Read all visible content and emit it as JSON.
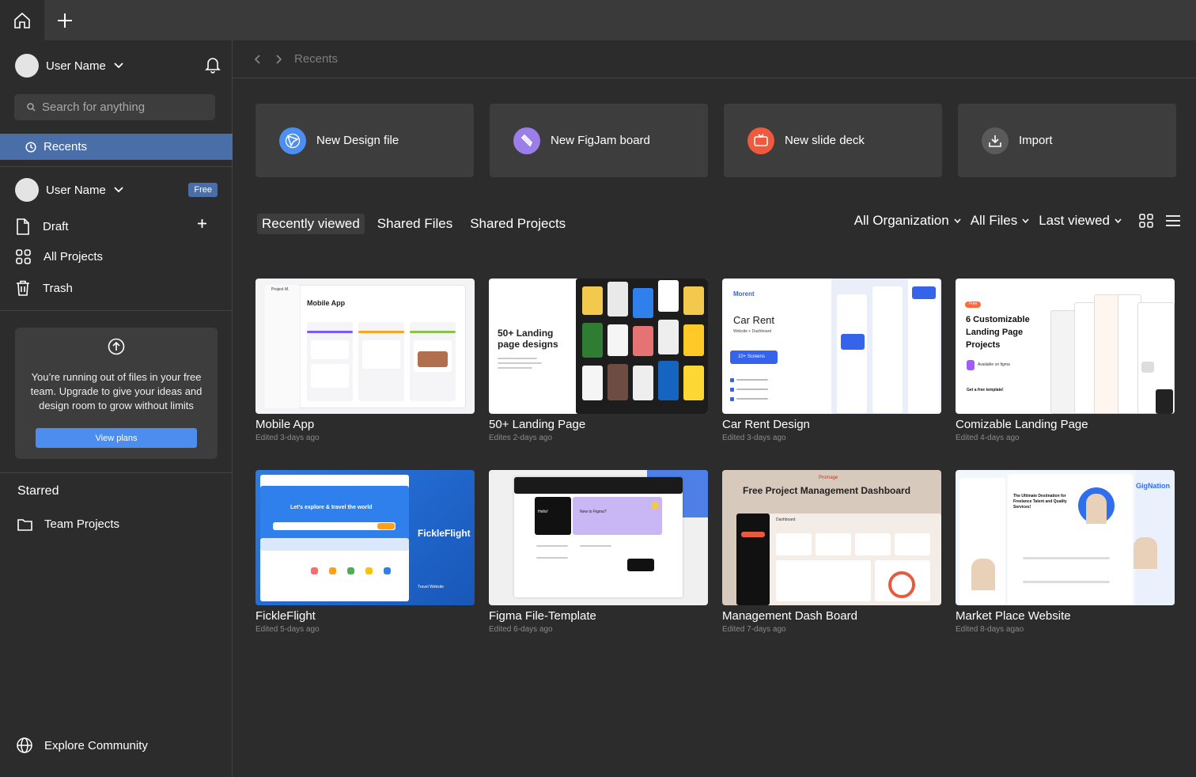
{
  "sidebar": {
    "user_name": "User Name",
    "search_placeholder": "Search for anything",
    "recents_label": "Recents",
    "team_user_name": "User Name",
    "plan_badge": "Free",
    "nav": {
      "draft": "Draft",
      "all_projects": "All Projects",
      "trash": "Trash"
    },
    "upgrade": {
      "message": "You’re running out of files in your free team. Upgrade to give your ideas and design room to grow without limits",
      "button": "View plans"
    },
    "starred_title": "Starred",
    "team_projects": "Team Projects",
    "explore": "Explore Community"
  },
  "breadcrumb": {
    "current": "Recents"
  },
  "actions": [
    {
      "label": "New Design file",
      "color": "#4d8ff0"
    },
    {
      "label": "New FigJam board",
      "color": "#9b7ee8"
    },
    {
      "label": "New slide deck",
      "color": "#ef5a3c"
    },
    {
      "label": "Import",
      "color": "#5a5a5a"
    }
  ],
  "tabs": [
    "Recently viewed",
    "Shared Files",
    "Shared Projects"
  ],
  "filters": [
    "All Organization",
    "All Files",
    "Last viewed"
  ],
  "files": [
    {
      "title": "Mobile App",
      "meta": "Edited 3-days ago",
      "thumb": {
        "heading": "Mobile App",
        "brand": "Project M."
      }
    },
    {
      "title": "50+ Landing Page",
      "meta": "Edites 2-days ago",
      "thumb": {
        "heading": "50+ Landing page designs"
      }
    },
    {
      "title": "Car Rent Design",
      "meta": "Edited 3-days ago",
      "thumb": {
        "brand": "Morent",
        "heading": "Car Rent",
        "sub": "Website + Dashboard",
        "button": "10+ Screens"
      }
    },
    {
      "title": "Comizable Landing Page",
      "meta": "Edited 4-days ago",
      "thumb": {
        "tag": "Free",
        "heading": "6 Customizable Landing Page Projects",
        "sub": "Available on figma",
        "cta": "Get a free template!"
      }
    },
    {
      "title": "FickleFlight",
      "meta": "Edited 5-days ago",
      "thumb": {
        "hero": "Let's explore & travel the world",
        "brand": "FickleFlight",
        "caption": "Travel Website"
      }
    },
    {
      "title": "Figma File-Template",
      "meta": "Edited 6-days ago",
      "thumb": {
        "hello": "Hello!",
        "card": "New to Figma?"
      }
    },
    {
      "title": "Management Dash Board",
      "meta": "Edited 7-days ago",
      "thumb": {
        "brand": "Promage",
        "heading": "Free Project Management Dashboard",
        "panel": "Dashboard"
      }
    },
    {
      "title": "Market  Place Website",
      "meta": "Edited 8-days agao",
      "thumb": {
        "brand": "GigNation",
        "heading": "The Ultimate Destination for Freelance Talent and Quality Services!"
      }
    }
  ]
}
